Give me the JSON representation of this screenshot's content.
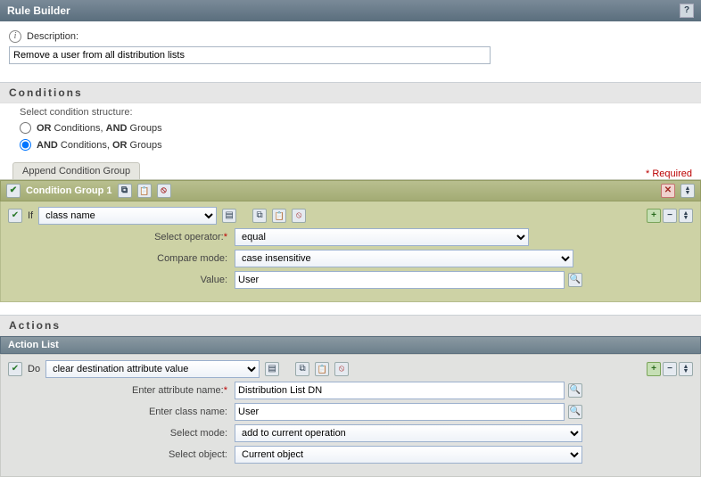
{
  "title": "Rule Builder",
  "description": {
    "label": "Description:",
    "value": "Remove a user from all distribution lists"
  },
  "conditions": {
    "heading": "Conditions",
    "structure_label": "Select condition structure:",
    "options": {
      "or_and": "OR Conditions, AND Groups",
      "and_or": "AND Conditions, OR Groups"
    },
    "selected": "and_or",
    "append_button": "Append Condition Group",
    "required_label": "* Required",
    "group_title": "Condition Group 1",
    "if_label": "If",
    "class_name_select": "class name",
    "labels": {
      "select_operator": "Select operator:",
      "compare_mode": "Compare mode:",
      "value": "Value:"
    },
    "values": {
      "operator": "equal",
      "compare_mode": "case insensitive",
      "value": "User"
    }
  },
  "actions": {
    "heading": "Actions",
    "list_title": "Action List",
    "do_label": "Do",
    "action_select": "clear destination attribute value",
    "labels": {
      "attribute_name": "Enter attribute name:",
      "class_name": "Enter class name:",
      "select_mode": "Select mode:",
      "select_object": "Select object:"
    },
    "values": {
      "attribute_name": "Distribution List DN",
      "class_name": "User",
      "mode": "add to current operation",
      "object": "Current object"
    }
  }
}
